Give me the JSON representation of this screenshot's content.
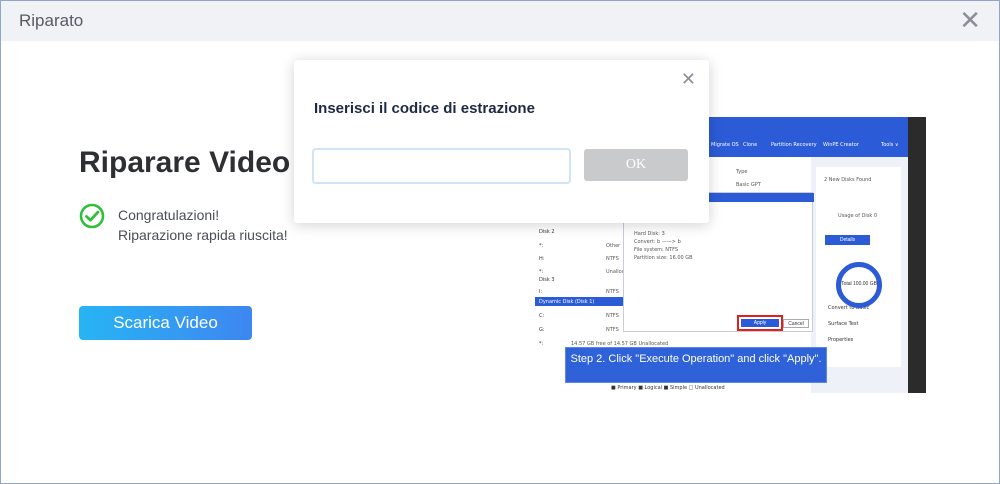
{
  "window": {
    "title": "Riparato",
    "close_glyph": "✕"
  },
  "main": {
    "heading": "Riparare Video",
    "status_lines": [
      "Congratulazioni!",
      "Riparazione rapida riuscita!"
    ],
    "download_label": "Scarica Video",
    "check_color": "#2fbf3a",
    "accent": "#3e86f0"
  },
  "thumbnail": {
    "toolbar_items": [
      "Migrate OS",
      "Clone",
      "Partition Recovery",
      "WinPE Creator",
      "Tools ∨"
    ],
    "left_rows": [
      {
        "col1": "Type",
        "col2": ""
      },
      {
        "col1": "Basic GPT",
        "col2": ""
      }
    ],
    "disk_rows": [
      "Disk 2",
      "*:",
      "H:",
      "*:",
      "Disk 3",
      "I:",
      "Dynamic Disk (Disk 1)",
      "C:",
      "G:",
      "*:"
    ],
    "disk_fs": [
      "Other",
      "NTFS",
      "Unallocated",
      "NTFS",
      "NTFS",
      "NTFS",
      "Unallocated"
    ],
    "dialog_fields": [
      "Hard Disk:   3",
      "Convert:     b ——> b",
      "File system:  NTFS",
      "Partition size:  16.00 GB"
    ],
    "unallocated_row": "14.57 GB free of   14.57 GB   Unallocated",
    "apply_label": "Apply",
    "cancel_label": "Cancel",
    "banner_text": "Step 2. Click \"Execute Operation\" and click \"Apply\".",
    "legend": "■ Primary  ■ Logical  ■ Simple  □ Unallocated",
    "disks_found": "2 New Disks Found",
    "details_label": "Details",
    "usage_label": "Usage of Disk 0",
    "ring_total": "Total 100.00 GB",
    "actions": [
      "Convert to Basic",
      "Surface Test",
      "Properties"
    ]
  },
  "modal": {
    "title": "Inserisci il codice di estrazione",
    "input_value": "",
    "input_placeholder": "",
    "ok_label": "OK",
    "close_glyph": "✕"
  }
}
